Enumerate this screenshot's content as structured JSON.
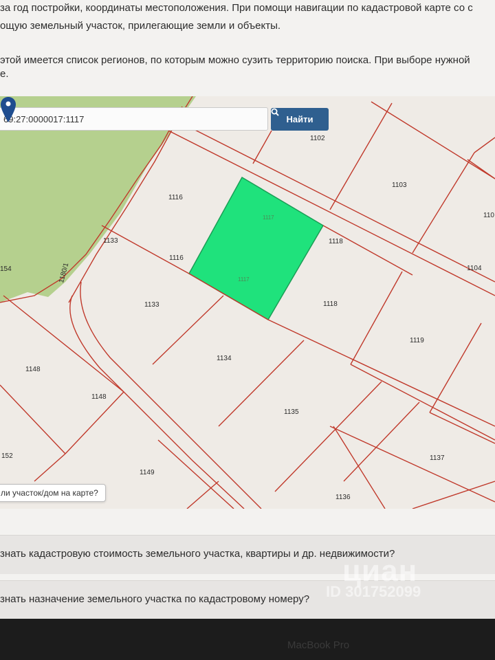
{
  "intro": {
    "line1": "за год постройки, координаты местоположения. При помощи навигации по кадастровой карте со с",
    "line2": "ощую земельный участок, прилегающие земли и объекты.",
    "line3": "этой имеется список регионов, по которым можно сузить территорию поиска. При выборе нужной",
    "line4": "е."
  },
  "search": {
    "value": "69:27:0000017:1117",
    "button_label": "Найти",
    "icon": "search-icon"
  },
  "map": {
    "selected_color": "#1fe27c",
    "line_color": "#c0392b",
    "forest_color": "#b5d08e",
    "labels": {
      "l1102": "1102",
      "l1103": "1103",
      "l110": "110",
      "l1116a": "1116",
      "l1116b": "1116",
      "l1133a": "1133",
      "l1133b": "1133",
      "l1118a": "1118",
      "l1118b": "1118",
      "l1104": "1104",
      "l154": "154",
      "l1180": "1180/1",
      "l1119": "1119",
      "l1134": "1134",
      "l1148a": "1148",
      "l1148b": "1148",
      "l1135": "1135",
      "l1152": "152",
      "l1149": "1149",
      "l1137": "1137",
      "l1136": "1136",
      "sel_top": "1117",
      "sel_mid": "1117"
    },
    "hint": "ли участок/дом на карте?"
  },
  "faq": {
    "q1": "знать кадастровую стоимость земельного участка, квартиры и др. недвижимости?",
    "q2": "знать назначение земельного участка по кадастровому номеру?"
  },
  "watermark": {
    "logo": "циан",
    "id": "ID 301752099"
  },
  "laptop": {
    "label": "MacBook Pro"
  }
}
